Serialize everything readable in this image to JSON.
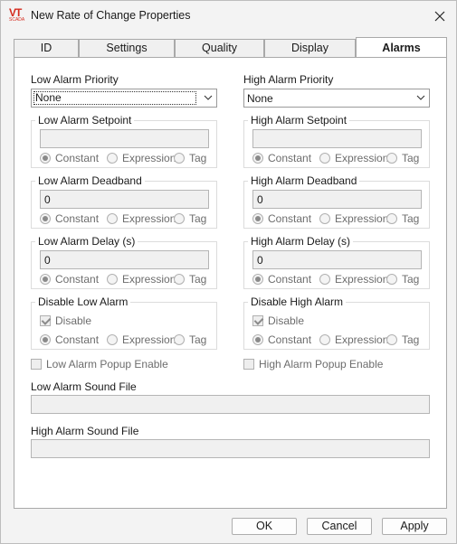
{
  "window": {
    "title": "New Rate of Change Properties",
    "icon_name": "vtscada-app-icon",
    "icon_text": "VT",
    "icon_subtext": "SCADA",
    "close_icon": "close-icon"
  },
  "tabs": [
    {
      "label": "ID",
      "active": false
    },
    {
      "label": "Settings",
      "active": false
    },
    {
      "label": "Quality",
      "active": false
    },
    {
      "label": "Display",
      "active": false
    },
    {
      "label": "Alarms",
      "active": true
    }
  ],
  "low_priority": {
    "label": "Low Alarm Priority",
    "value": "None"
  },
  "high_priority": {
    "label": "High Alarm Priority",
    "value": "None"
  },
  "radio_labels": {
    "constant": "Constant",
    "expression": "Expression",
    "tag": "Tag"
  },
  "low_setpoint": {
    "title": "Low Alarm Setpoint",
    "value": "",
    "selected": "Constant"
  },
  "high_setpoint": {
    "title": "High Alarm Setpoint",
    "value": "",
    "selected": "Constant"
  },
  "low_deadband": {
    "title": "Low Alarm Deadband",
    "value": "0",
    "selected": "Constant"
  },
  "high_deadband": {
    "title": "High Alarm Deadband",
    "value": "0",
    "selected": "Constant"
  },
  "low_delay": {
    "title": "Low Alarm Delay (s)",
    "value": "0",
    "selected": "Constant"
  },
  "high_delay": {
    "title": "High Alarm Delay (s)",
    "value": "0",
    "selected": "Constant"
  },
  "low_disable": {
    "title": "Disable Low Alarm",
    "checkbox_label": "Disable",
    "checked": true,
    "selected": "Constant"
  },
  "high_disable": {
    "title": "Disable High Alarm",
    "checkbox_label": "Disable",
    "checked": true,
    "selected": "Constant"
  },
  "low_popup": {
    "label": "Low Alarm Popup Enable",
    "checked": false
  },
  "high_popup": {
    "label": "High Alarm Popup Enable",
    "checked": false
  },
  "low_sound": {
    "label": "Low Alarm Sound File",
    "value": ""
  },
  "high_sound": {
    "label": "High Alarm Sound File",
    "value": ""
  },
  "buttons": {
    "ok": "OK",
    "cancel": "Cancel",
    "apply": "Apply"
  }
}
